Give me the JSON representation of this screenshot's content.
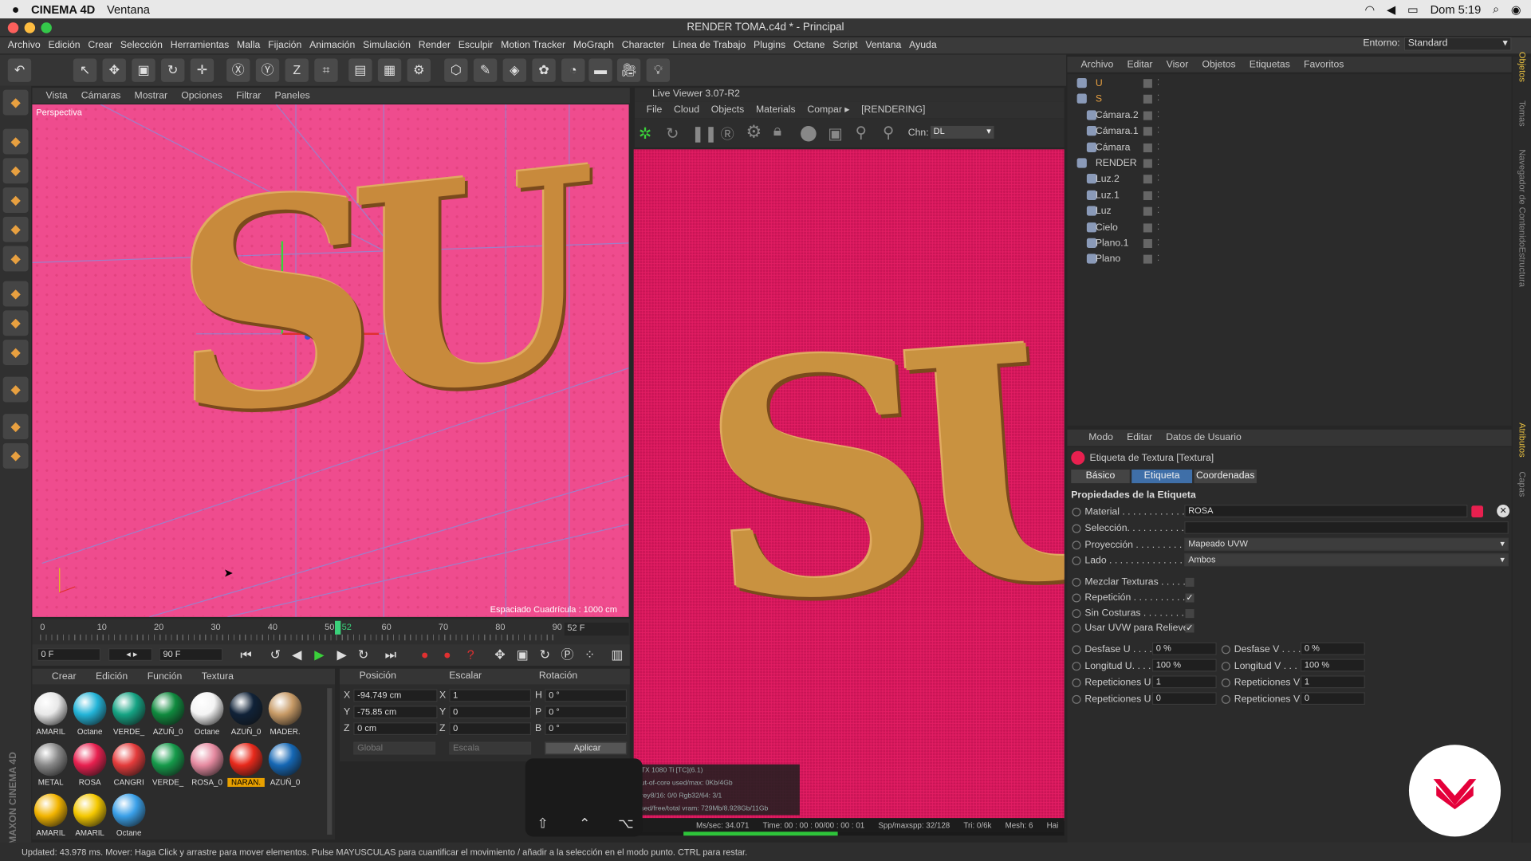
{
  "macbar": {
    "app": "CINEMA 4D",
    "menu": "Ventana",
    "clock": "Dom 5:19"
  },
  "window": {
    "title": "RENDER TOMA.c4d * - Principal"
  },
  "menu": {
    "items": [
      "Archivo",
      "Edición",
      "Crear",
      "Selección",
      "Herramientas",
      "Malla",
      "Fijación",
      "Animación",
      "Simulación",
      "Render",
      "Esculpir",
      "Motion Tracker",
      "MoGraph",
      "Character",
      "Línea de Trabajo",
      "Plugins",
      "Octane",
      "Script",
      "Ventana",
      "Ayuda"
    ],
    "entorno_label": "Entorno:",
    "entorno_value": "Standard"
  },
  "viewport": {
    "menu": [
      "Vista",
      "Cámaras",
      "Mostrar",
      "Opciones",
      "Filtrar",
      "Paneles"
    ],
    "label": "Perspectiva",
    "grid_info": "Espaciado Cuadrícula : 1000 cm",
    "text": "SU"
  },
  "timeline": {
    "ticks": [
      "0",
      "10",
      "20",
      "30",
      "40",
      "50",
      "60",
      "70",
      "80",
      "90"
    ],
    "current": "52",
    "end": "52 F"
  },
  "transport": {
    "start": "0 F",
    "end": "90 F"
  },
  "materials": {
    "menu": [
      "Crear",
      "Edición",
      "Función",
      "Textura"
    ],
    "items": [
      {
        "name": "AMARIL",
        "color": "#e8e8e8"
      },
      {
        "name": "Octane",
        "color": "#23b4d8"
      },
      {
        "name": "VERDE_",
        "color": "#15a383"
      },
      {
        "name": "AZUÑ_0",
        "color": "#0f8a3e"
      },
      {
        "name": "Octane",
        "color": "#f4f4f4"
      },
      {
        "name": "AZUÑ_0",
        "color": "#102238"
      },
      {
        "name": "MADER.",
        "color": "#c79a66"
      },
      {
        "name": "METAL",
        "color": "#888888"
      },
      {
        "name": "ROSA",
        "color": "#e8204f"
      },
      {
        "name": "CANGRI",
        "color": "#e43b3b"
      },
      {
        "name": "VERDE_",
        "color": "#159a4a"
      },
      {
        "name": "ROSA_0",
        "color": "#e58aa0"
      },
      {
        "name": "NARAN.",
        "color": "#e8291b"
      },
      {
        "name": "AZUÑ_0",
        "color": "#1567b4"
      },
      {
        "name": "AMARIL",
        "color": "#f2b400"
      },
      {
        "name": "AMARIL",
        "color": "#f4c800"
      },
      {
        "name": "Octane",
        "color": "#3aa0e8"
      }
    ]
  },
  "coords": {
    "headers": [
      "Posición",
      "Escalar",
      "Rotación"
    ],
    "rows": [
      {
        "axis": "X",
        "pos": "-94.749 cm",
        "sax": "X",
        "scale": "1",
        "rax": "H",
        "rot": "0 °"
      },
      {
        "axis": "Y",
        "pos": "-75.85 cm",
        "sax": "Y",
        "scale": "0",
        "rax": "P",
        "rot": "0 °"
      },
      {
        "axis": "Z",
        "pos": "0 cm",
        "sax": "Z",
        "scale": "0",
        "rax": "B",
        "rot": "0 °"
      }
    ],
    "mode1": "Global",
    "mode2": "Escala",
    "apply": "Aplicar"
  },
  "liveviewer": {
    "title": "Live Viewer 3.07-R2",
    "menu": [
      "File",
      "Cloud",
      "Objects",
      "Materials",
      "Compar ▸",
      "[RENDERING]"
    ],
    "chn_label": "Chn:",
    "chn_value": "DL",
    "status": [
      "Ms/sec: 34.071",
      "Time: 00 : 00 : 00/00 : 00 : 01",
      "Spp/maxspp: 32/128",
      "Tri: 0/6k",
      "Mesh: 6",
      "Hai"
    ],
    "overlay": [
      "GTX 1080 Ti [TC](6.1)",
      "Out-of-core used/max: 0Kb/4Gb",
      "Grey8/16: 0/0          Rgb32/64: 3/1",
      "Used/free/total vram: 729Mb/8.928Gb/11Gb"
    ]
  },
  "objects": {
    "menu": [
      "Archivo",
      "Editar",
      "Visor",
      "Objetos",
      "Etiquetas",
      "Favoritos"
    ],
    "items": [
      {
        "name": "U",
        "indent": 0,
        "color": "#e8a040"
      },
      {
        "name": "S",
        "indent": 0,
        "color": "#e8a040"
      },
      {
        "name": "Cámara.2",
        "indent": 1,
        "color": "#ccc"
      },
      {
        "name": "Cámara.1",
        "indent": 1,
        "color": "#ccc"
      },
      {
        "name": "Cámara",
        "indent": 1,
        "color": "#ccc"
      },
      {
        "name": "RENDER",
        "indent": 0,
        "color": "#ccc"
      },
      {
        "name": "Luz.2",
        "indent": 1,
        "color": "#ccc"
      },
      {
        "name": "Luz.1",
        "indent": 1,
        "color": "#ccc"
      },
      {
        "name": "Luz",
        "indent": 1,
        "color": "#ccc"
      },
      {
        "name": "Cielo",
        "indent": 1,
        "color": "#ccc"
      },
      {
        "name": "Plano.1",
        "indent": 1,
        "color": "#ccc"
      },
      {
        "name": "Plano",
        "indent": 1,
        "color": "#ccc"
      }
    ]
  },
  "attributes": {
    "menu": [
      "Modo",
      "Editar",
      "Datos de Usuario"
    ],
    "tag_title": "Etiqueta de Textura [Textura]",
    "tabs": [
      "Básico",
      "Etiqueta",
      "Coordenadas"
    ],
    "section": "Propiedades de la Etiqueta",
    "material_label": "Material . . . . . . . . . . . .",
    "material_value": "ROSA",
    "seleccion_label": "Selección. . . . . . . . . . . .",
    "proyeccion_label": "Proyección . . . . . . . . . .",
    "proyeccion_value": "Mapeado UVW",
    "lado_label": "Lado . . . . . . . . . . . . . .",
    "lado_value": "Ambos",
    "mezclar": "Mezclar Texturas . . . . .",
    "repeticion": "Repetición . . . . . . . . . .",
    "sincosturas": "Sin Costuras . . . . . . . .",
    "usaruvw": "Usar UVW para Relieve",
    "desfase_u": "Desfase U . . . .",
    "desfase_u_val": "0 %",
    "desfase_v": "Desfase V . . . .",
    "desfase_v_val": "0 %",
    "longitud_u": "Longitud U. . . .",
    "longitud_u_val": "100 %",
    "longitud_v": "Longitud V . . . .",
    "longitud_v_val": "100 %",
    "rep_u": "Repeticiones U",
    "rep_u_val": "1",
    "rep_v": "Repeticiones V",
    "rep_v_val": "1",
    "rep_u2": "Repeticiones U",
    "rep_u2_val": "0",
    "rep_v2": "Repeticiones V",
    "rep_v2_val": "0"
  },
  "rightstrip": [
    "Objetos",
    "Tomas",
    "Navegador de Contenido",
    "Estructura",
    "Atributos",
    "Capas"
  ],
  "status": {
    "text": "Updated: 43.978 ms.     Mover: Haga Click y arrastre para mover elementos. Pulse MAYUSCULAS para cuantificar el movimiento / añadir a la selección en el modo punto. CTRL para restar."
  },
  "brand": {
    "side": "MAXON CINEMA 4D"
  }
}
